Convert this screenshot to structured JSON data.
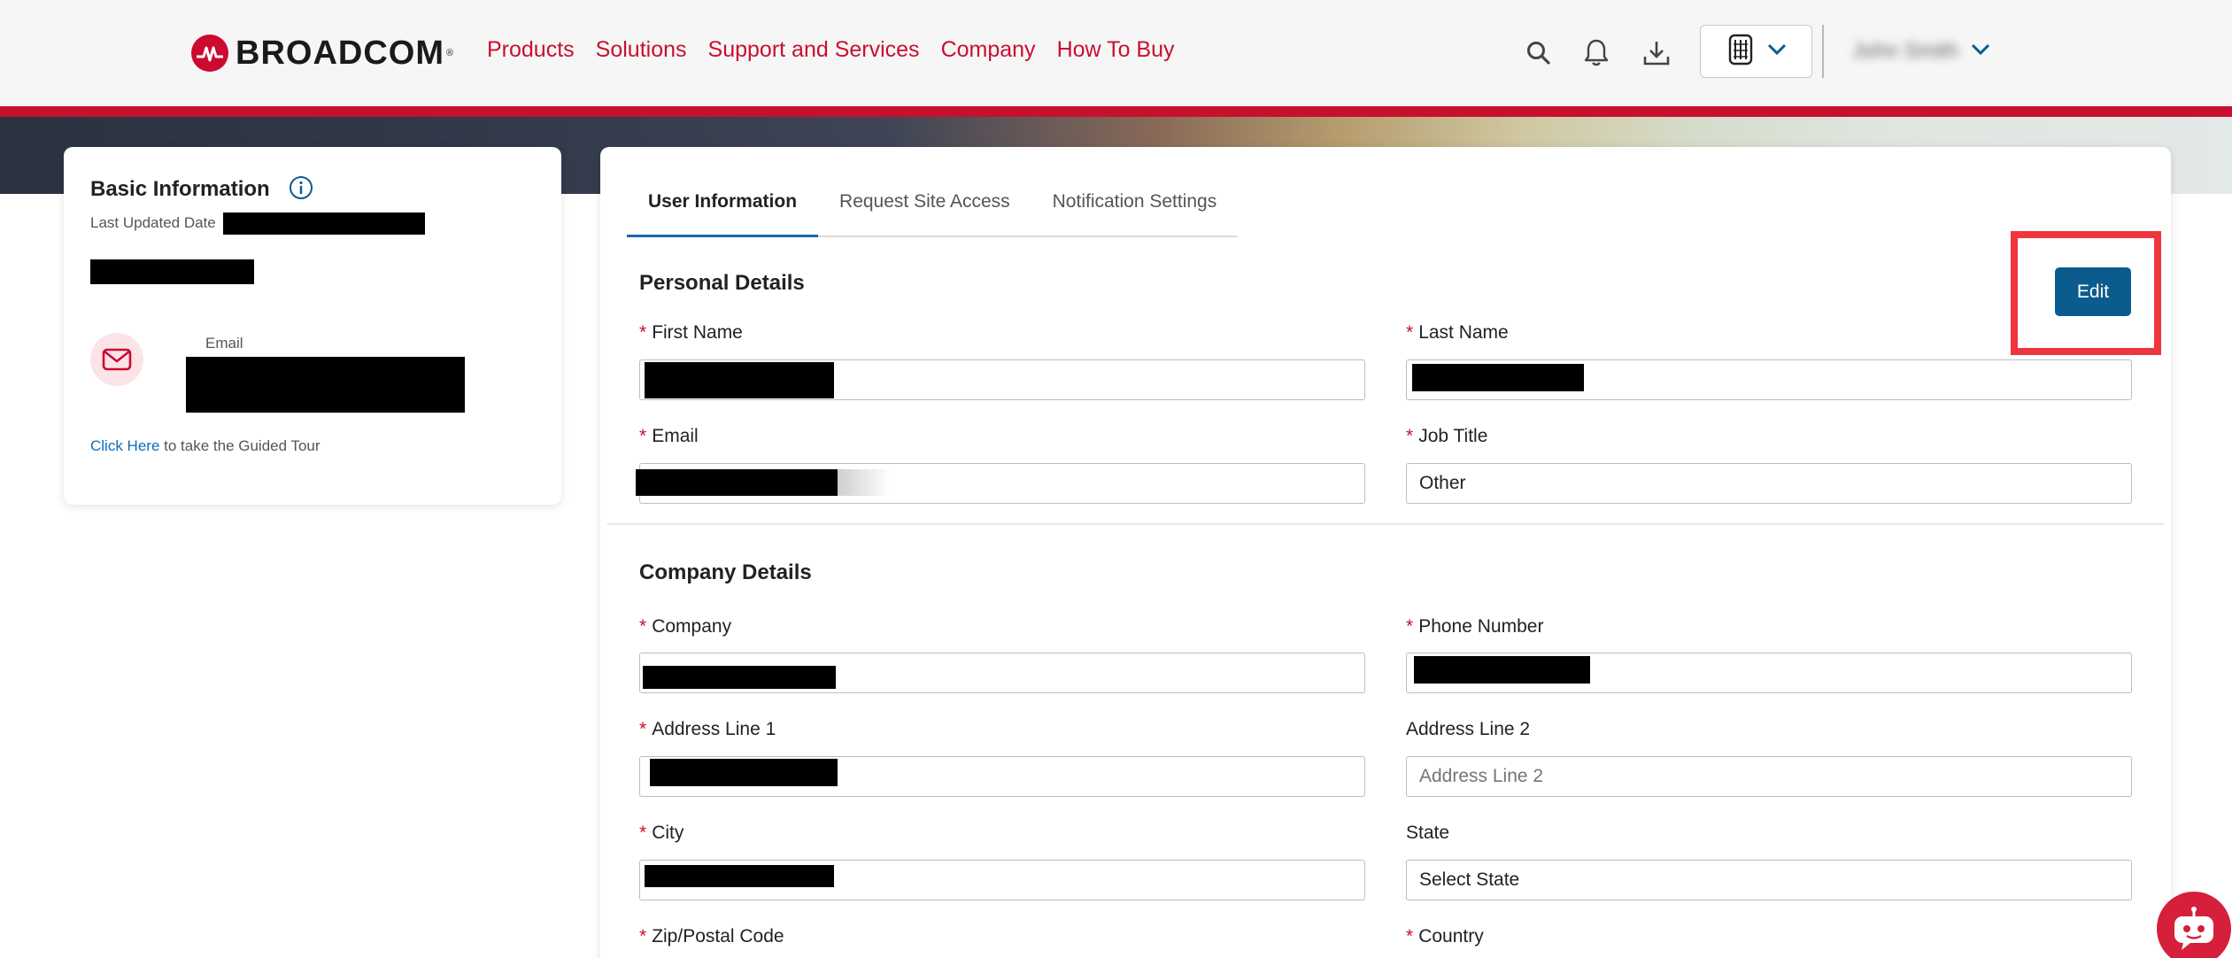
{
  "header": {
    "logo_text": "BROADCOM",
    "logo_tm": "®",
    "nav": [
      "Products",
      "Solutions",
      "Support and Services",
      "Company",
      "How To Buy"
    ],
    "user_name": "John Smith",
    "accent": "#c8102e"
  },
  "icons": {
    "search": "search-icon",
    "notifications": "bell-icon",
    "downloads": "download-icon",
    "tenant": "tenant-icon",
    "chevron": "chevron-down-icon",
    "info": "info-icon",
    "mail": "mail-icon",
    "chat": "chatbot-icon"
  },
  "basic_info": {
    "title": "Basic Information",
    "last_updated_label": "Last Updated Date",
    "email_label": "Email",
    "tour_link": "Click Here",
    "tour_text": " to take the Guided Tour"
  },
  "tabs": [
    {
      "label": "User Information",
      "active": true
    },
    {
      "label": "Request Site Access",
      "active": false
    },
    {
      "label": "Notification Settings",
      "active": false
    }
  ],
  "personal": {
    "title": "Personal Details",
    "edit_label": "Edit",
    "first_name_label": "First Name",
    "last_name_label": "Last Name",
    "email_label": "Email",
    "job_title_label": "Job Title",
    "job_title_value": "Other"
  },
  "company": {
    "title": "Company Details",
    "company_label": "Company",
    "phone_label": "Phone Number",
    "address1_label": "Address Line 1",
    "address2_label": "Address Line 2",
    "address2_placeholder": "Address Line 2",
    "city_label": "City",
    "state_label": "State",
    "state_value": "Select State",
    "zip_label": "Zip/Postal Code",
    "country_label": "Country"
  },
  "required_marker": "*"
}
